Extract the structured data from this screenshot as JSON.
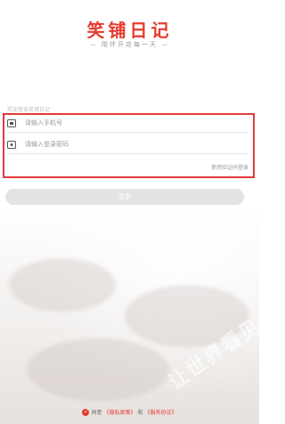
{
  "app": {
    "title": "笑铺日记",
    "slogan": "— 陪伴开店每一天 —",
    "accent": "#e63b2e"
  },
  "login": {
    "welcome": "欢迎登录笑铺日记",
    "phone_placeholder": "请输入手机号",
    "password_placeholder": "请输入登录密码",
    "code_login_link": "使用验证码登录",
    "login_button": "登录"
  },
  "agreement": {
    "prefix": "同意",
    "privacy": "《隐私政策》",
    "and": "和",
    "service": "《服务协议》"
  },
  "background": {
    "watermark": "让世界看见"
  }
}
